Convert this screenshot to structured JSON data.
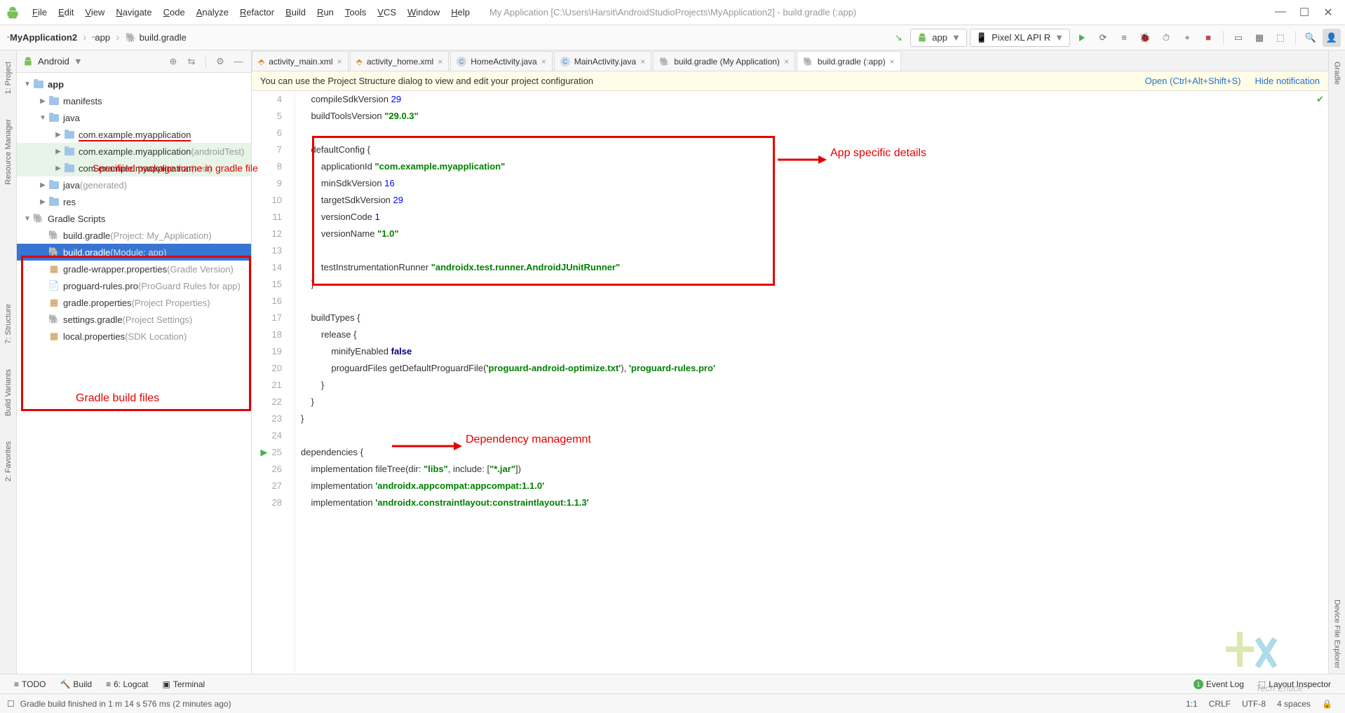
{
  "menu": {
    "items": [
      "File",
      "Edit",
      "View",
      "Navigate",
      "Code",
      "Analyze",
      "Refactor",
      "Build",
      "Run",
      "Tools",
      "VCS",
      "Window",
      "Help"
    ],
    "title": "My Application [C:\\Users\\Harsit\\AndroidStudioProjects\\MyApplication2] - build.gradle (:app)"
  },
  "breadcrumb": {
    "root": "MyApplication2",
    "mid": "app",
    "leaf": "build.gradle"
  },
  "run": {
    "config": "app",
    "device": "Pixel XL API R"
  },
  "project": {
    "header": "Android",
    "tree": [
      {
        "depth": 0,
        "arrow": "▼",
        "icon": "folder",
        "label": "app",
        "bold": true
      },
      {
        "depth": 1,
        "arrow": "▶",
        "icon": "folder",
        "label": "manifests"
      },
      {
        "depth": 1,
        "arrow": "▼",
        "icon": "folder",
        "label": "java"
      },
      {
        "depth": 2,
        "arrow": "▶",
        "icon": "folder",
        "label": "com.example.myapplication",
        "underline": true
      },
      {
        "depth": 2,
        "arrow": "▶",
        "icon": "folder",
        "label": "com.example.myapplication",
        "dim": "(androidTest)",
        "hl": true
      },
      {
        "depth": 2,
        "arrow": "▶",
        "icon": "folder",
        "label": "com.example.myapplication",
        "dim": "(test)",
        "hl": true
      },
      {
        "depth": 1,
        "arrow": "▶",
        "icon": "folder",
        "label": "java",
        "dim": "(generated)"
      },
      {
        "depth": 1,
        "arrow": "▶",
        "icon": "folder",
        "label": "res"
      },
      {
        "depth": 0,
        "arrow": "▼",
        "icon": "gradle",
        "label": "Gradle Scripts"
      },
      {
        "depth": 1,
        "arrow": "",
        "icon": "gradle",
        "label": "build.gradle",
        "dim": "(Project: My_Application)"
      },
      {
        "depth": 1,
        "arrow": "",
        "icon": "gradle",
        "label": "build.gradle",
        "dim": "(Module: app)",
        "selected": true
      },
      {
        "depth": 1,
        "arrow": "",
        "icon": "prop",
        "label": "gradle-wrapper.properties",
        "dim": "(Gradle Version)"
      },
      {
        "depth": 1,
        "arrow": "",
        "icon": "file",
        "label": "proguard-rules.pro",
        "dim": "(ProGuard Rules for app)"
      },
      {
        "depth": 1,
        "arrow": "",
        "icon": "prop",
        "label": "gradle.properties",
        "dim": "(Project Properties)"
      },
      {
        "depth": 1,
        "arrow": "",
        "icon": "gradle",
        "label": "settings.gradle",
        "dim": "(Project Settings)"
      },
      {
        "depth": 1,
        "arrow": "",
        "icon": "prop",
        "label": "local.properties",
        "dim": "(SDK Location)"
      }
    ]
  },
  "tabs": [
    {
      "icon": "xml",
      "label": "activity_main.xml"
    },
    {
      "icon": "xml",
      "label": "activity_home.xml"
    },
    {
      "icon": "java",
      "label": "HomeActivity.java"
    },
    {
      "icon": "java",
      "label": "MainActivity.java"
    },
    {
      "icon": "gradle",
      "label": "build.gradle (My Application)"
    },
    {
      "icon": "gradle",
      "label": "build.gradle (:app)",
      "active": true
    }
  ],
  "notif": {
    "msg": "You can use the Project Structure dialog to view and edit your project configuration",
    "open": "Open (Ctrl+Alt+Shift+S)",
    "hide": "Hide notification"
  },
  "code": {
    "start": 4,
    "lines": [
      {
        "n": 4,
        "t": "    compileSdkVersion ",
        "num": "29"
      },
      {
        "n": 5,
        "t": "    buildToolsVersion ",
        "str": "\"29.0.3\""
      },
      {
        "n": 6,
        "t": ""
      },
      {
        "n": 7,
        "t": "    defaultConfig {"
      },
      {
        "n": 8,
        "t": "        applicationId ",
        "str": "\"com.example.myapplication\""
      },
      {
        "n": 9,
        "t": "        minSdkVersion ",
        "num": "16"
      },
      {
        "n": 10,
        "t": "        targetSdkVersion ",
        "num": "29"
      },
      {
        "n": 11,
        "t": "        versionCode ",
        "num": "1"
      },
      {
        "n": 12,
        "t": "        versionName ",
        "str": "\"1.0\""
      },
      {
        "n": 13,
        "t": ""
      },
      {
        "n": 14,
        "t": "        testInstrumentationRunner ",
        "str": "\"androidx.test.runner.AndroidJUnitRunner\""
      },
      {
        "n": 15,
        "t": "    }"
      },
      {
        "n": 16,
        "t": ""
      },
      {
        "n": 17,
        "t": "    buildTypes {"
      },
      {
        "n": 18,
        "t": "        release {"
      },
      {
        "n": 19,
        "t": "            minifyEnabled ",
        "bool": "false"
      },
      {
        "n": 20,
        "t": "            proguardFiles getDefaultProguardFile(",
        "str": "'proguard-android-optimize.txt'",
        "t2": "), ",
        "str2": "'proguard-rules.pro'"
      },
      {
        "n": 21,
        "t": "        }"
      },
      {
        "n": 22,
        "t": "    }"
      },
      {
        "n": 23,
        "t": "}"
      },
      {
        "n": 24,
        "t": ""
      },
      {
        "n": 25,
        "t": "dependencies {",
        "play": true
      },
      {
        "n": 26,
        "t": "    implementation fileTree(dir: ",
        "str": "\"libs\"",
        "t2": ", include: [",
        "str2": "\"*.jar\"",
        "t3": "])"
      },
      {
        "n": 27,
        "t": "    implementation ",
        "str": "'androidx.appcompat:appcompat:1.1.0'"
      },
      {
        "n": 28,
        "t": "    implementation ",
        "str": "'androidx.constraintlayout:constraintlayout:1.1.3'"
      }
    ]
  },
  "annotations": {
    "a1": "Specifiied package name in gradle file",
    "a2": "App specific details",
    "a3": "Gradle build files",
    "a4": "Dependency managemnt"
  },
  "left_strip": [
    "1: Project",
    "Resource Manager",
    "7: Structure",
    "Build Variants",
    "2: Favorites"
  ],
  "right_strip": [
    "Gradle",
    "Device File Explorer"
  ],
  "bottom": {
    "todo": "TODO",
    "build": "Build",
    "logcat": "6: Logcat",
    "terminal": "Terminal",
    "eventlog": "Event Log",
    "layout": "Layout Inspector"
  },
  "status": {
    "msg": "Gradle build finished in 1 m 14 s 576 ms (2 minutes ago)",
    "pos": "1:1",
    "eol": "CRLF",
    "enc": "UTF-8",
    "indent": "4 spaces"
  },
  "watermark": "Tech Entice"
}
